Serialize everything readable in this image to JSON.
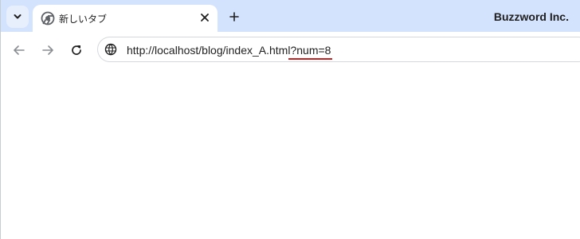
{
  "tab": {
    "title": "新しいタブ"
  },
  "brand": {
    "text": "Buzzword Inc."
  },
  "address_bar": {
    "url_base": "http://localhost/blog/index_A.html",
    "url_query": "?num=8",
    "highlight_color": "#cc1f1f"
  },
  "icons": {
    "tab_search": "chevron-down-icon",
    "tab_favicon": "chrome-icon",
    "tab_close": "close-icon",
    "new_tab": "plus-icon",
    "back": "arrow-left-icon",
    "forward": "arrow-right-icon",
    "reload": "reload-icon",
    "site_info": "globe-icon"
  },
  "colors": {
    "tabstrip_bg": "#d3e3fd",
    "toolbar_bg": "#ffffff"
  }
}
